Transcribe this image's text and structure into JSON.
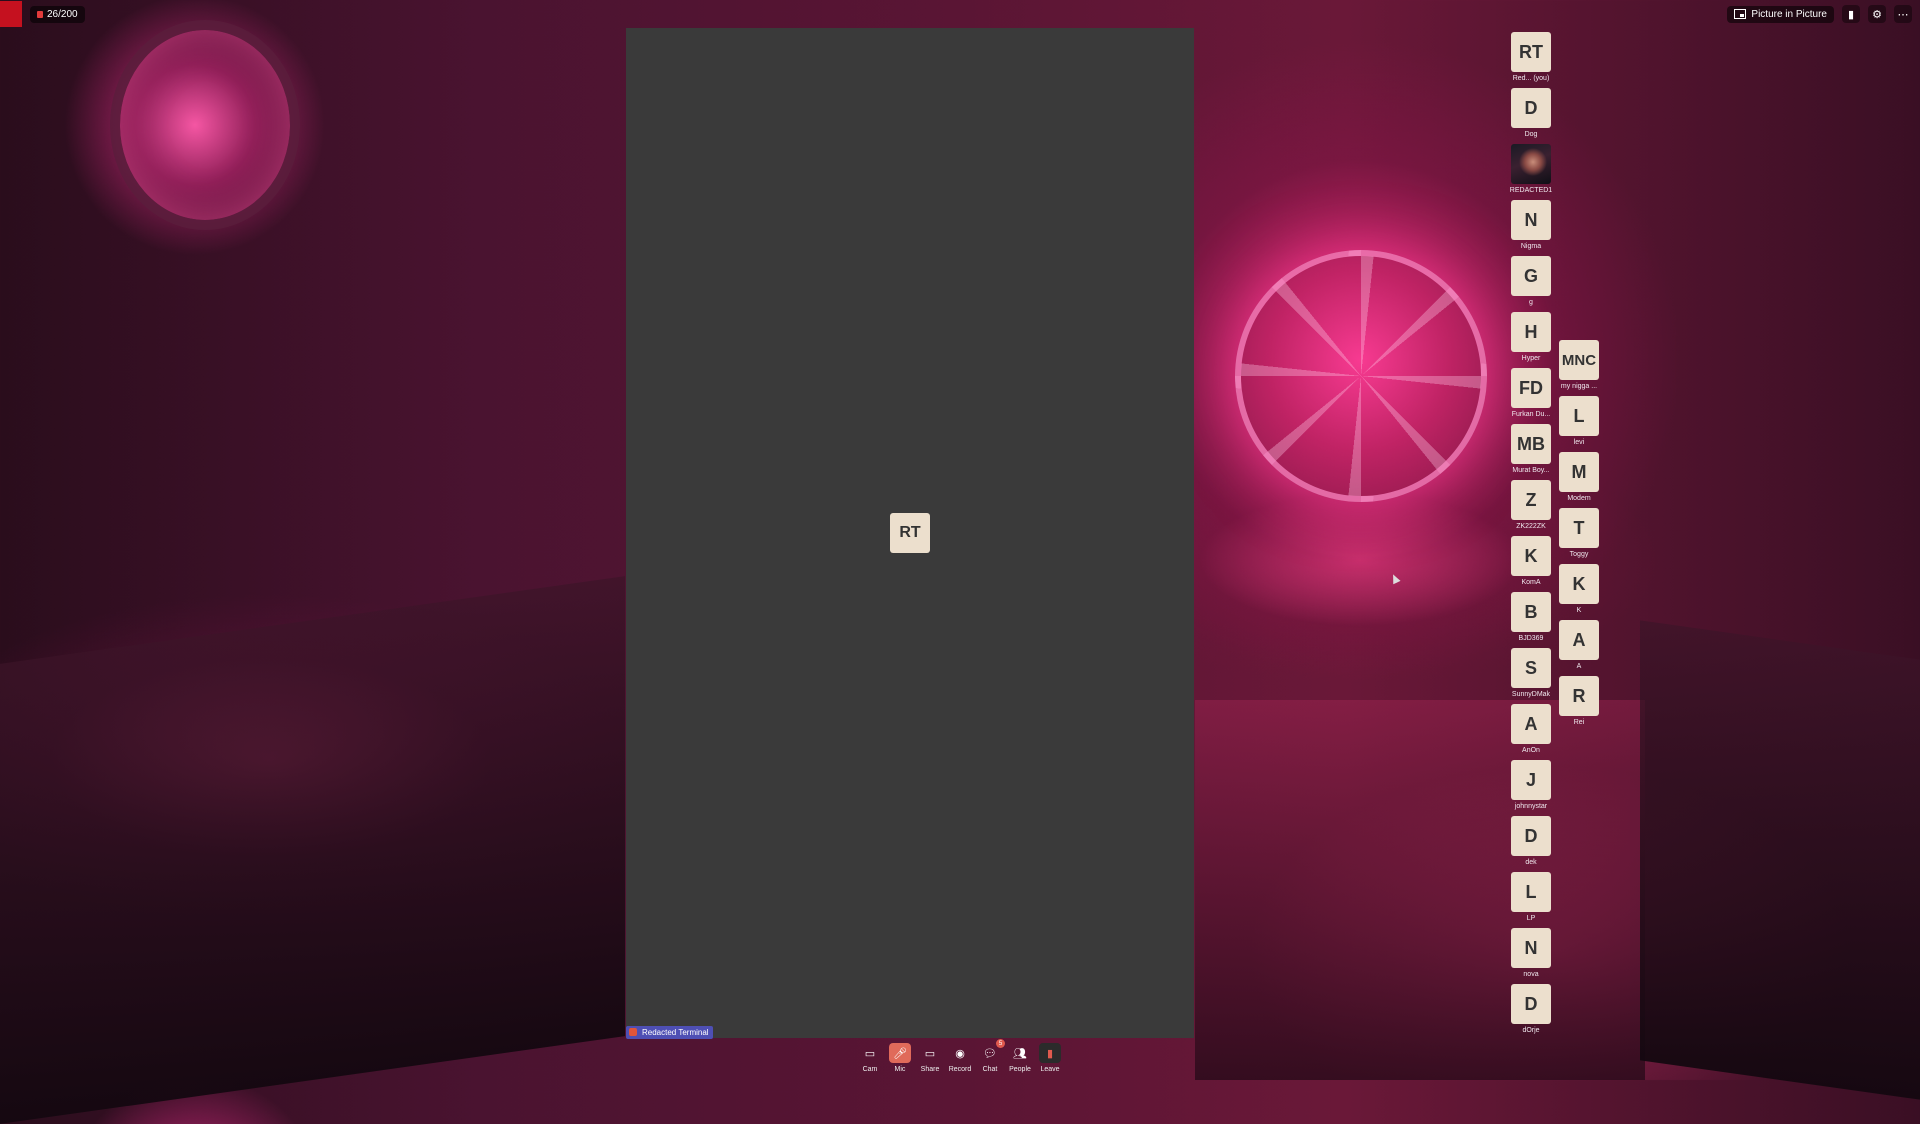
{
  "topbar": {
    "participant_count": "26/200",
    "pip_label": "Picture in Picture",
    "icons": [
      "lock-icon",
      "signal-icon",
      "settings-icon",
      "more-icon"
    ]
  },
  "stage": {
    "initials": "RT",
    "label": "Redacted Terminal"
  },
  "participants_col1": [
    {
      "initials": "RT",
      "name": "Red... (you)"
    },
    {
      "initials": "D",
      "name": "Dog"
    },
    {
      "initials": "",
      "name": "REDACTED1",
      "avatar": "photo-avatar"
    },
    {
      "initials": "N",
      "name": "Nigma"
    },
    {
      "initials": "G",
      "name": "g"
    },
    {
      "initials": "H",
      "name": "Hyper"
    },
    {
      "initials": "FD",
      "name": "Furkan Du..."
    },
    {
      "initials": "MB",
      "name": "Murat Boy..."
    },
    {
      "initials": "Z",
      "name": "ZK222ZK"
    },
    {
      "initials": "K",
      "name": "KomA"
    },
    {
      "initials": "B",
      "name": "BJD369"
    },
    {
      "initials": "S",
      "name": "SunnyDMak"
    },
    {
      "initials": "A",
      "name": "AnOn"
    },
    {
      "initials": "J",
      "name": "johnnystar"
    },
    {
      "initials": "D",
      "name": "dek"
    },
    {
      "initials": "L",
      "name": "LP"
    },
    {
      "initials": "N",
      "name": "nova"
    },
    {
      "initials": "D",
      "name": "dOrje"
    }
  ],
  "participants_col2": [
    {
      "initials": "MNC",
      "name": "my nigga ..."
    },
    {
      "initials": "L",
      "name": "levi"
    },
    {
      "initials": "M",
      "name": "Modem"
    },
    {
      "initials": "T",
      "name": "Toggy"
    },
    {
      "initials": "K",
      "name": "K"
    },
    {
      "initials": "A",
      "name": "A"
    },
    {
      "initials": "R",
      "name": "Rei"
    }
  ],
  "toolbar": {
    "cam": "Cam",
    "mic": "Mic",
    "share": "Share",
    "record": "Record",
    "chat": "Chat",
    "chat_badge": "5",
    "people": "People",
    "leave": "Leave"
  }
}
